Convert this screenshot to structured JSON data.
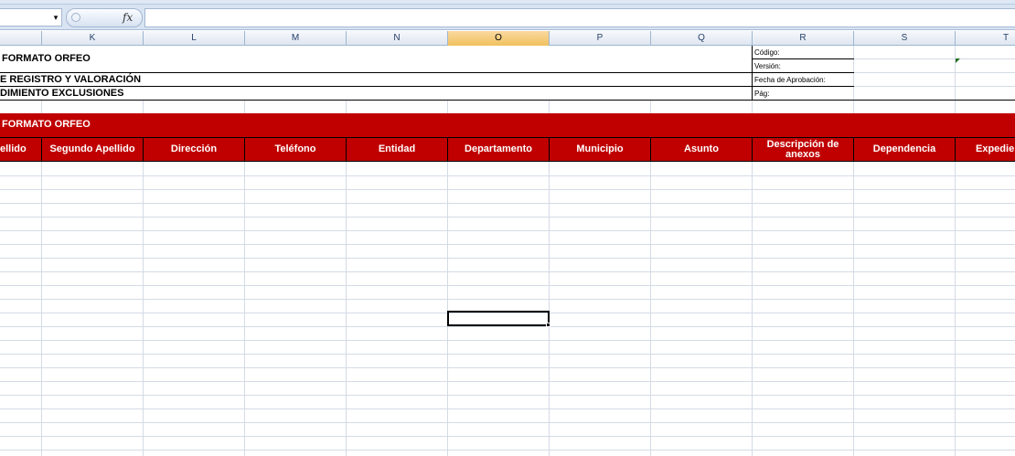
{
  "formula_bar": {
    "name_box_value": "",
    "dropdown_glyph": "▾",
    "fx_label": "fx",
    "formula_value": ""
  },
  "columns": [
    {
      "letter": "K",
      "selected": false
    },
    {
      "letter": "L",
      "selected": false
    },
    {
      "letter": "M",
      "selected": false
    },
    {
      "letter": "N",
      "selected": false
    },
    {
      "letter": "O",
      "selected": true
    },
    {
      "letter": "P",
      "selected": false
    },
    {
      "letter": "Q",
      "selected": false
    },
    {
      "letter": "R",
      "selected": false
    },
    {
      "letter": "S",
      "selected": false
    },
    {
      "letter": "T",
      "selected": false
    }
  ],
  "document_header": {
    "title_1": "FORMATO ORFEO",
    "title_2": "E REGISTRO Y VALORACIÓN",
    "title_3": "DIMIENTO EXCLUSIONES",
    "meta_labels": {
      "codigo": "Código:",
      "version": "Versión:",
      "fecha": "Fecha de Aprobación:",
      "pag": "Pág:"
    }
  },
  "banner": {
    "text": "FORMATO ORFEO"
  },
  "table_headers": [
    "ellido",
    "Segundo Apellido",
    "Dirección",
    "Teléfono",
    "Entidad",
    "Departamento",
    "Municipio",
    "Asunto",
    "Descripción de anexos",
    "Dependencia",
    "Expedie"
  ],
  "colors": {
    "accent_red": "#c00000",
    "selected_col": "#f1c15f",
    "grid": "#d4dbe6"
  }
}
